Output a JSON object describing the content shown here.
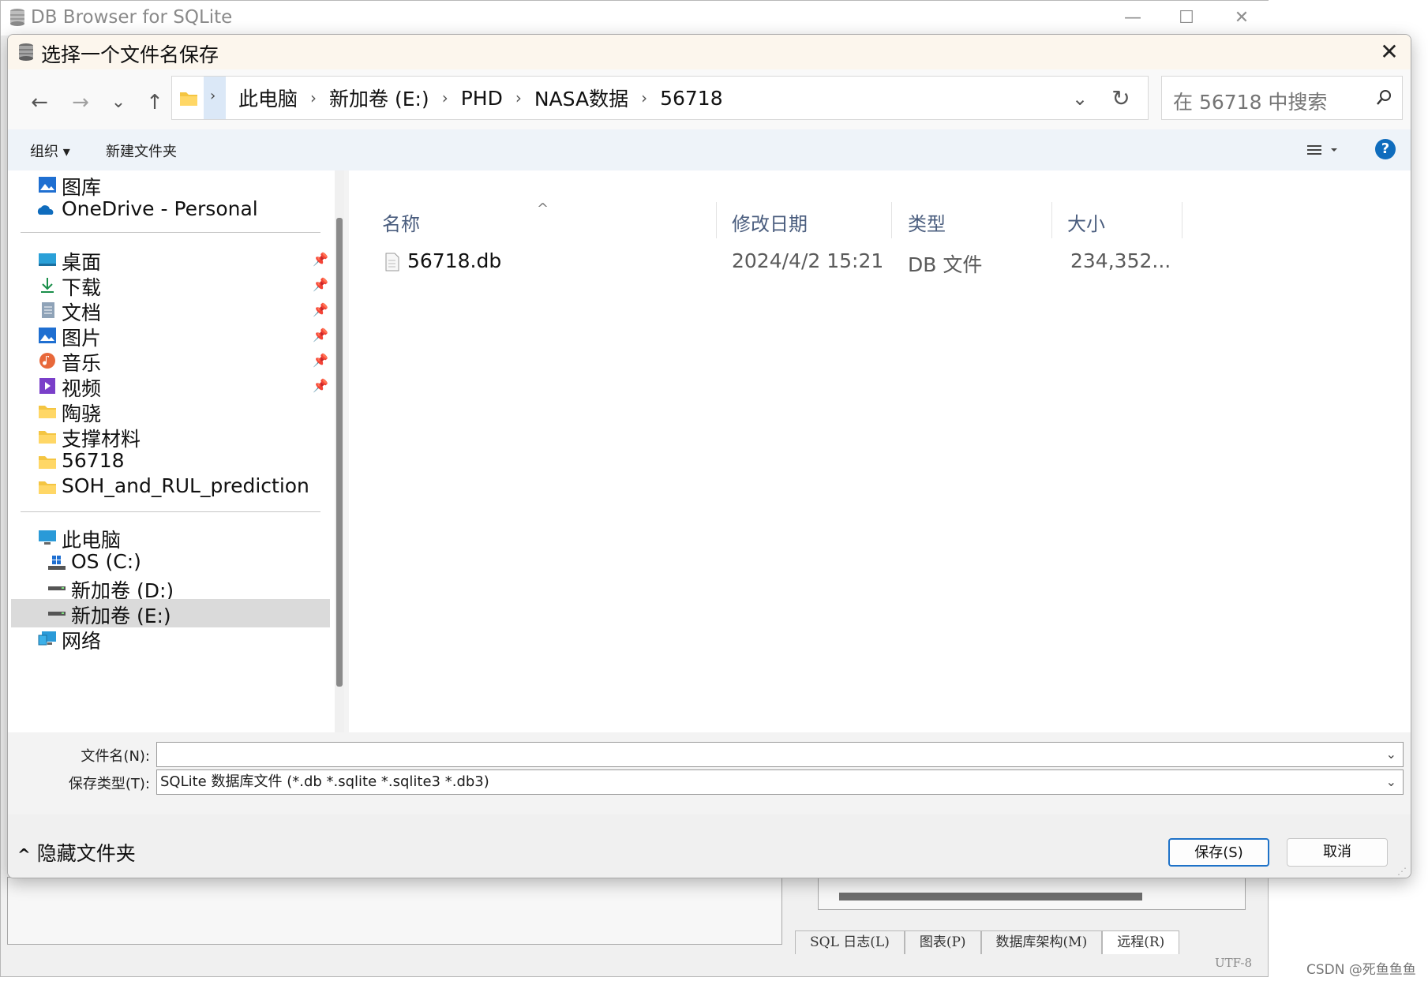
{
  "background_window": {
    "title": "DB Browser for SQLite",
    "controls": {
      "minimize": "—",
      "maximize": "☐",
      "close": "✕"
    },
    "tabs": [
      "SQL 日志(L)",
      "图表(P)",
      "数据库架构(M)",
      "远程(R)"
    ],
    "encoding": "UTF-8",
    "watermark": "CSDN @死鱼鱼鱼"
  },
  "dialog": {
    "title": "选择一个文件名保存",
    "close": "✕",
    "nav_buttons": {
      "back": "←",
      "forward": "→",
      "recent": "⌄",
      "up": "↑"
    },
    "breadcrumb": [
      "此电脑",
      "新加卷 (E:)",
      "PHD",
      "NASA数据",
      "56718"
    ],
    "breadcrumb_separator": "›",
    "search_placeholder": "在 56718 中搜索",
    "toolbar": {
      "organize": "组织 ▾",
      "new_folder": "新建文件夹",
      "help": "?"
    },
    "nav_pane": {
      "top_items": [
        {
          "label": "图库",
          "icon": "gallery-icon"
        },
        {
          "label": "OneDrive - Personal",
          "icon": "onedrive-icon"
        }
      ],
      "quick_access": [
        {
          "label": "桌面",
          "icon": "desktop-icon",
          "pinned": true
        },
        {
          "label": "下载",
          "icon": "download-icon",
          "pinned": true
        },
        {
          "label": "文档",
          "icon": "document-icon",
          "pinned": true
        },
        {
          "label": "图片",
          "icon": "pictures-icon",
          "pinned": true
        },
        {
          "label": "音乐",
          "icon": "music-icon",
          "pinned": true
        },
        {
          "label": "视频",
          "icon": "video-icon",
          "pinned": true
        },
        {
          "label": "陶骁",
          "icon": "folder-icon",
          "pinned": false
        },
        {
          "label": "支撑材料",
          "icon": "folder-icon",
          "pinned": false
        },
        {
          "label": "56718",
          "icon": "folder-icon",
          "pinned": false
        },
        {
          "label": "SOH_and_RUL_prediction",
          "icon": "folder-icon",
          "pinned": false
        }
      ],
      "this_pc": {
        "label": "此电脑",
        "icon": "computer-icon"
      },
      "drives": [
        {
          "label": "OS (C:)",
          "icon": "windows-drive-icon"
        },
        {
          "label": "新加卷 (D:)",
          "icon": "drive-icon"
        },
        {
          "label": "新加卷 (E:)",
          "icon": "drive-icon",
          "selected": true
        }
      ],
      "network": {
        "label": "网络",
        "icon": "network-icon"
      }
    },
    "columns": [
      "名称",
      "修改日期",
      "类型",
      "大小"
    ],
    "files": [
      {
        "name": "56718.db",
        "modified": "2024/4/2 15:21",
        "type": "DB 文件",
        "size": "234,352..."
      }
    ],
    "filename_label": "文件名(N):",
    "filename_value": "",
    "filetype_label": "保存类型(T):",
    "filetype_value": "SQLite 数据库文件 (*.db *.sqlite *.sqlite3 *.db3)",
    "hide_folders": "隐藏文件夹",
    "save_button": "保存(S)",
    "cancel_button": "取消",
    "colors": {
      "accent": "#0f6cbd",
      "selection": "#dadada",
      "title_bg": "#fcf6ed"
    }
  }
}
